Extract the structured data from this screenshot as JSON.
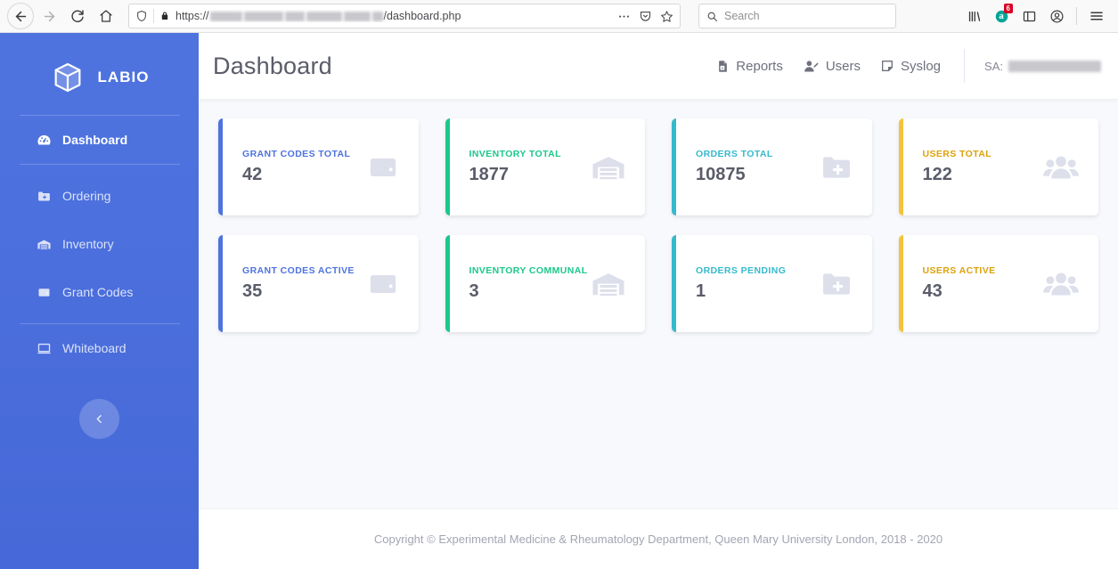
{
  "browser": {
    "back_label": "Back",
    "forward_label": "Forward",
    "reload_label": "Reload",
    "home_label": "Home",
    "url_prefix": "https://",
    "url_suffix": "/dashboard.php",
    "url_redacted": true,
    "search_placeholder": "Search",
    "extension_badge": "6",
    "icons": {
      "shield": "shield-icon",
      "lock": "lock-icon",
      "page_actions": "ellipsis-icon",
      "pocket": "pocket-icon",
      "bookmark": "star-icon",
      "library": "library-icon",
      "extension": "extension-icon",
      "sidebar": "sidebar-toggle-icon",
      "account": "account-icon",
      "menu": "hamburger-menu-icon"
    }
  },
  "sidebar": {
    "brand": "LABIO",
    "brand_icon": "cube-logo-icon",
    "collapse_icon": "chevron-left-icon",
    "items": [
      {
        "label": "Dashboard",
        "icon": "tachometer-icon",
        "active": true
      },
      {
        "label": "Ordering",
        "icon": "folder-plus-icon",
        "active": false
      },
      {
        "label": "Inventory",
        "icon": "warehouse-icon",
        "active": false
      },
      {
        "label": "Grant Codes",
        "icon": "wallet-icon",
        "active": false
      },
      {
        "label": "Whiteboard",
        "icon": "chalkboard-icon",
        "active": false
      }
    ]
  },
  "topbar": {
    "title": "Dashboard",
    "nav": [
      {
        "label": "Reports",
        "icon": "file-excel-icon"
      },
      {
        "label": "Users",
        "icon": "user-edit-icon"
      },
      {
        "label": "Syslog",
        "icon": "sticky-note-icon"
      }
    ],
    "account_prefix": "SA:",
    "account_name_redacted": true
  },
  "cards": [
    {
      "label": "GRANT CODES TOTAL",
      "value": "42",
      "color": "#4e73df",
      "icon": "wallet-icon"
    },
    {
      "label": "INVENTORY TOTAL",
      "value": "1877",
      "color": "#1cc88a",
      "icon": "warehouse-icon"
    },
    {
      "label": "ORDERS TOTAL",
      "value": "10875",
      "color": "#36b9cc",
      "icon": "folder-plus-icon"
    },
    {
      "label": "USERS TOTAL",
      "value": "122",
      "color": "#f6c23e",
      "icon": "users-icon"
    },
    {
      "label": "GRANT CODES ACTIVE",
      "value": "35",
      "color": "#4e73df",
      "icon": "wallet-icon"
    },
    {
      "label": "INVENTORY COMMUNAL",
      "value": "3",
      "color": "#1cc88a",
      "icon": "warehouse-icon"
    },
    {
      "label": "ORDERS PENDING",
      "value": "1",
      "color": "#36b9cc",
      "icon": "folder-plus-icon"
    },
    {
      "label": "USERS ACTIVE",
      "value": "43",
      "color": "#f6c23e",
      "icon": "users-icon"
    }
  ],
  "footer": {
    "copyright": "Copyright © Experimental Medicine & Rheumatology Department, Queen Mary University London, 2018 - 2020"
  },
  "theme": {
    "sidebar_bg": "#4e73df",
    "content_bg": "#f8f9fc",
    "title_color": "#5a5c69",
    "icon_gray": "#dddfeb"
  }
}
